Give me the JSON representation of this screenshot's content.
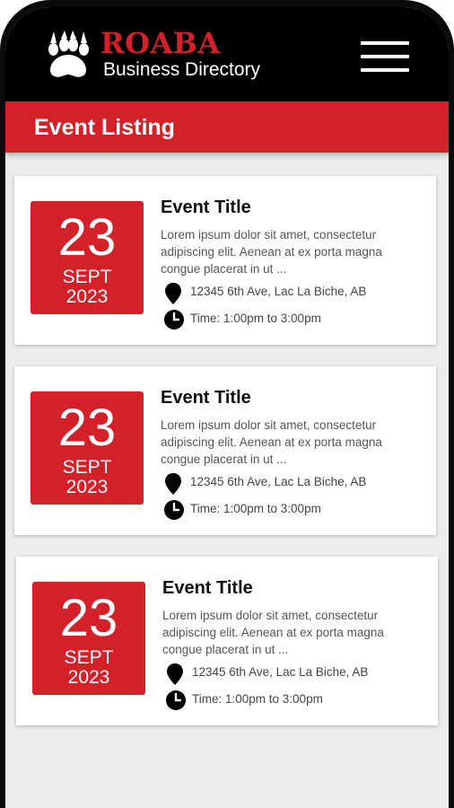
{
  "brand": {
    "name": "ROABA",
    "subtitle": "Business Directory",
    "logo_icon": "paw-icon"
  },
  "header": {
    "title": "Event Listing",
    "menu_icon": "hamburger-menu-icon"
  },
  "colors": {
    "accent": "#d42028",
    "topbar": "#000000",
    "background": "#ececec",
    "card": "#ffffff"
  },
  "events": [
    {
      "day": "23",
      "month": "SEPT",
      "year": "2023",
      "title": "Event Title",
      "description": "Lorem ipsum dolor sit amet, consectetur adipiscing elit. Aenean at ex porta magna congue placerat in ut  ...",
      "location": "12345 6th Ave, Lac La Biche, AB",
      "time": "Time: 1:00pm to 3:00pm"
    },
    {
      "day": "23",
      "month": "SEPT",
      "year": "2023",
      "title": "Event Title",
      "description": "Lorem ipsum dolor sit amet, consectetur adipiscing elit. Aenean at ex porta magna congue placerat in ut  ...",
      "location": "12345 6th Ave, Lac La Biche, AB",
      "time": "Time: 1:00pm to 3:00pm"
    },
    {
      "day": "23",
      "month": "SEPT",
      "year": "2023",
      "title": "Event Title",
      "description": "Lorem ipsum dolor sit amet, consectetur adipiscing elit. Aenean at ex porta magna congue placerat in ut  ...",
      "location": "12345 6th Ave, Lac La Biche, AB",
      "time": "Time: 1:00pm to 3:00pm"
    }
  ]
}
